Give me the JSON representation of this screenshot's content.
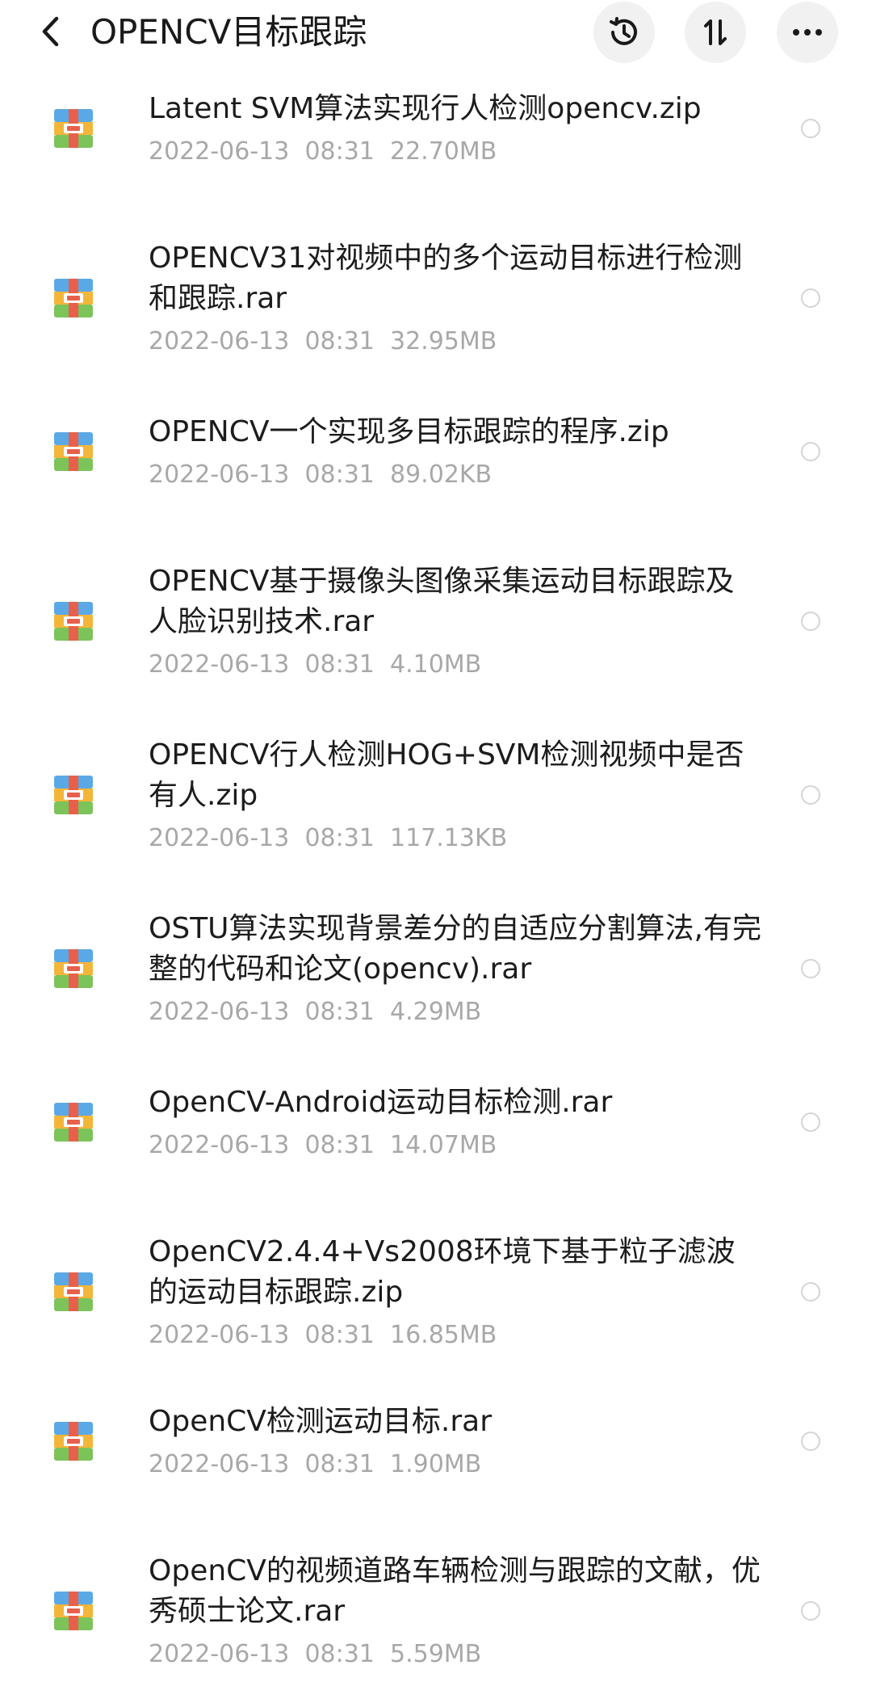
{
  "header": {
    "title": "OPENCV目标跟踪",
    "back_icon": "chevron-left-icon",
    "history_icon": "clock-history-icon",
    "sort_icon": "sort-arrows-icon",
    "more_icon": "ellipsis-icon"
  },
  "colors": {
    "meta_text": "#a8a8a8",
    "icon_blue": "#5aa9e6",
    "icon_yellow": "#f4b63a",
    "icon_red": "#e8604c",
    "icon_green": "#7cc35a",
    "button_bg": "#f1f1f1"
  },
  "files": [
    {
      "name": "Latent SVM算法实现行人检测opencv.zip",
      "date": "2022-06-13",
      "time": "08:31",
      "size": "22.70MB"
    },
    {
      "name": "OPENCV31对视频中的多个运动目标进行检测和跟踪.rar",
      "date": "2022-06-13",
      "time": "08:31",
      "size": "32.95MB"
    },
    {
      "name": "OPENCV一个实现多目标跟踪的程序.zip",
      "date": "2022-06-13",
      "time": "08:31",
      "size": "89.02KB"
    },
    {
      "name": "OPENCV基于摄像头图像采集运动目标跟踪及人脸识别技术.rar",
      "date": "2022-06-13",
      "time": "08:31",
      "size": "4.10MB"
    },
    {
      "name": "OPENCV行人检测HOG+SVM检测视频中是否有人.zip",
      "date": "2022-06-13",
      "time": "08:31",
      "size": "117.13KB"
    },
    {
      "name": "OSTU算法实现背景差分的自适应分割算法,有完整的代码和论文(opencv).rar",
      "date": "2022-06-13",
      "time": "08:31",
      "size": "4.29MB"
    },
    {
      "name": "OpenCV-Android运动目标检测.rar",
      "date": "2022-06-13",
      "time": "08:31",
      "size": "14.07MB"
    },
    {
      "name": "OpenCV2.4.4+Vs2008环境下基于粒子滤波的运动目标跟踪.zip",
      "date": "2022-06-13",
      "time": "08:31",
      "size": "16.85MB"
    },
    {
      "name": "OpenCV检测运动目标.rar",
      "date": "2022-06-13",
      "time": "08:31",
      "size": "1.90MB"
    },
    {
      "name": "OpenCV的视频道路车辆检测与跟踪的文献，优秀硕士论文.rar",
      "date": "2022-06-13",
      "time": "08:31",
      "size": "5.59MB"
    }
  ]
}
